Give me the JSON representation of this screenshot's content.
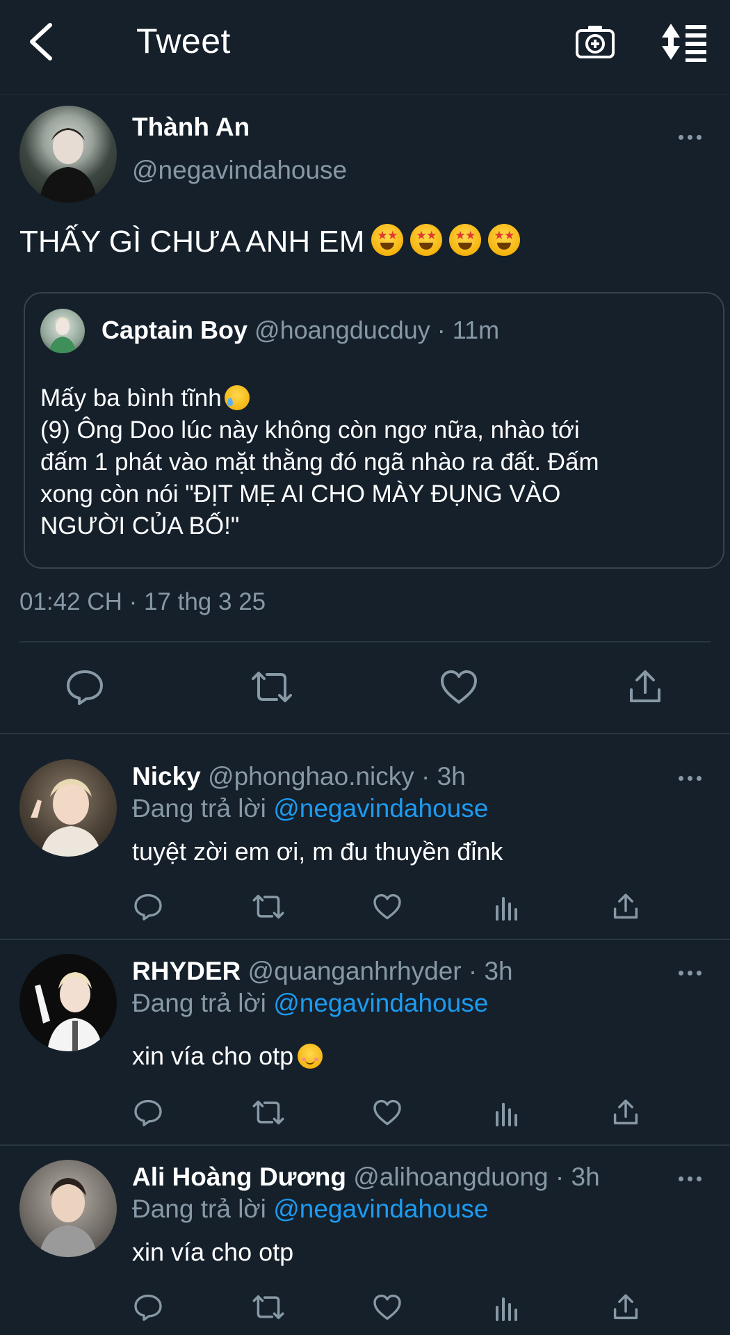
{
  "header": {
    "title": "Tweet"
  },
  "main_tweet": {
    "author_name": "Thành An",
    "author_handle": "@negavindahouse",
    "text": "THẤY GÌ CHƯA ANH EM",
    "timestamp": "01:42 CH · 17 thg 3 25",
    "quoted": {
      "author_name": "Captain Boy",
      "meta": "@hoangducduy · 11m",
      "lines": [
        "Mấy ba bình tĩnh",
        "(9) Ông Doo lúc này không còn ngơ nữa, nhào tới",
        "đấm 1 phát vào mặt thằng đó ngã nhào ra đất. Đấm",
        "xong còn nói \"ĐỊT MẸ AI CHO MÀY ĐỤNG VÀO",
        "NGƯỜI CỦA BỐ!\""
      ]
    }
  },
  "replies": [
    {
      "author_name": "Nicky",
      "meta": "@phonghao.nicky · 3h",
      "replying_label": "Đang trả lời",
      "replying_handle": "@negavindahouse",
      "text": "tuyệt zời em ơi, m đu thuyền đỉnk"
    },
    {
      "author_name": "RHYDER",
      "meta": "@quanganhrhyder · 3h",
      "replying_label": "Đang trả lời",
      "replying_handle": "@negavindahouse",
      "text": "xin vía cho otp"
    },
    {
      "author_name": "Ali Hoàng Dương",
      "meta": "@alihoangduong · 3h",
      "replying_label": "Đang trả lời",
      "replying_handle": "@negavindahouse",
      "text": "xin vía cho otp"
    }
  ],
  "colors": {
    "background": "#15202b",
    "muted": "#8899a6",
    "link": "#1d9bf0",
    "border": "#38444d"
  },
  "icons": [
    "back-arrow-icon",
    "camera-plus-icon",
    "sort-icon",
    "more-icon",
    "reply-icon",
    "retweet-icon",
    "like-icon",
    "analytics-icon",
    "share-icon"
  ]
}
